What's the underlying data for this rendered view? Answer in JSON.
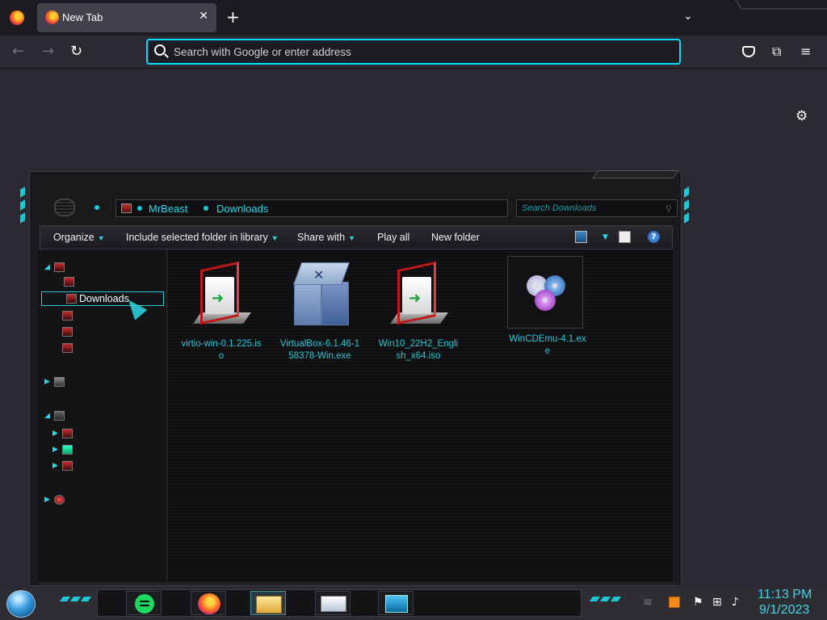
{
  "browser": {
    "tab_title": "New Tab",
    "tab_close": "✕",
    "new_tab": "+",
    "tab_list": "⌄",
    "back": "←",
    "forward": "→",
    "reload": "↻",
    "url_placeholder": "Search with Google or enter address",
    "extensions": "⧉",
    "menu": "≡",
    "settings": "⚙"
  },
  "explorer": {
    "breadcrumb": [
      "MrBeast",
      "Downloads"
    ],
    "search_placeholder": "Search Downloads",
    "toolbar": {
      "organize": "Organize",
      "include_folder": "Include selected folder in library",
      "share_with": "Share with",
      "play_all": "Play all",
      "new_folder": "New folder",
      "help": "?"
    },
    "nav": {
      "selected": "Downloads"
    },
    "files": [
      {
        "name": "virtio-win-0.1.225.iso",
        "icon": "iso-icon"
      },
      {
        "name": "VirtualBox-6.1.46-158378-Win.exe",
        "icon": "virtualbox-icon"
      },
      {
        "name": "Win10_22H2_English_x64.iso",
        "icon": "iso-icon"
      },
      {
        "name": "WinCDEmu-4.1.exe",
        "icon": "cd-icon"
      }
    ]
  },
  "taskbar": {
    "time": "11:13 PM",
    "date": "9/1/2023"
  }
}
